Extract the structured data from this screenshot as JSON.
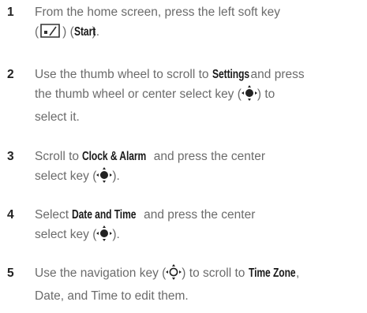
{
  "steps": [
    {
      "number": "1",
      "p1": "From the home screen, press the left soft key",
      "p2": "(",
      "icon": "left-soft-key-icon",
      "p3": ") (",
      "k1": "Start",
      "p4": ")."
    },
    {
      "number": "2",
      "p1": "Use the thumb wheel to scroll to ",
      "k1": "Settings",
      "p2": " and press",
      "p3": "the thumb wheel or center select key (",
      "icon": "center-select-key-icon",
      "p4": ") to",
      "p5": "select it."
    },
    {
      "number": "3",
      "p1": "Scroll to ",
      "k1": "Clock & Alarm",
      "p2": " and press the center",
      "p3": "select key (",
      "icon": "center-select-key-icon",
      "p4": ")."
    },
    {
      "number": "4",
      "p1": "Select ",
      "k1": "Date and Time",
      "p2": " and press the center",
      "p3": "select key (",
      "icon": "center-select-key-icon",
      "p4": ")."
    },
    {
      "number": "5",
      "p1": "Use the navigation key (",
      "icon": "navigation-key-icon",
      "p2": ") to scroll to ",
      "k1": "Time Zone",
      "p3": ",",
      "p4": "Date, and Time to edit them."
    }
  ]
}
